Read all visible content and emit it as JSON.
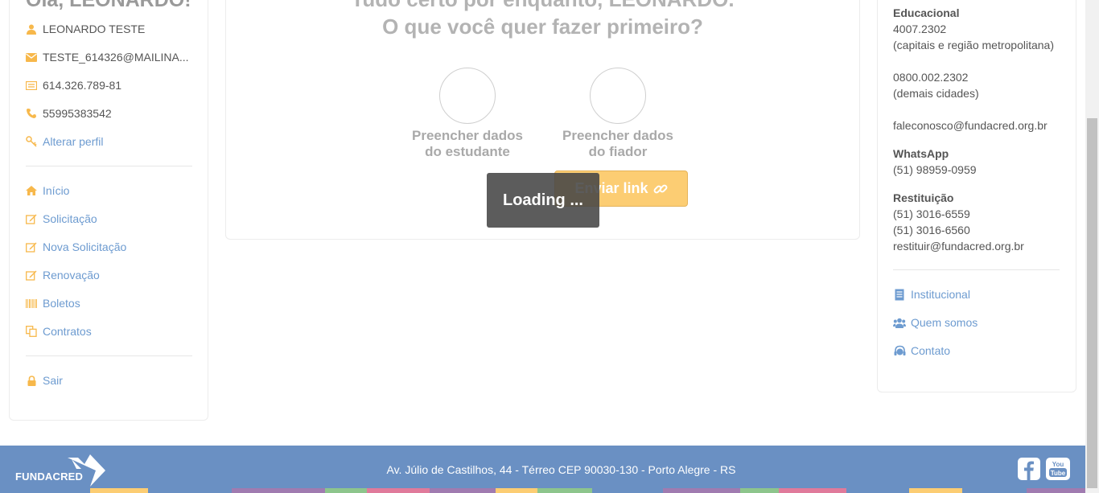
{
  "left": {
    "greeting": "Olá, LEONARDO!",
    "name": "LEONARDO TESTE",
    "email": "TESTE_614326@MAILINA...",
    "cpf": "614.326.789-81",
    "phone": "55995383542",
    "edit_profile": "Alterar perfil",
    "nav": [
      "Início",
      "Solicitação",
      "Nova Solicitação",
      "Renovação",
      "Boletos",
      "Contratos"
    ],
    "logout": "Sair"
  },
  "main": {
    "title_line1": "Tudo certo por enquanto, LEONARDO.",
    "title_line2": "O que você quer fazer primeiro?",
    "option_student_line1": "Preencher dados",
    "option_student_line2": "do estudante",
    "option_guarantor_line1": "Preencher dados",
    "option_guarantor_line2": "do fiador",
    "send_link": "Enviar link",
    "loading": "Loading ..."
  },
  "right": {
    "section_title": "Educacional",
    "phone1": "4007.2302",
    "phone1_note": "(capitais e região metropolitana)",
    "phone2": "0800.002.2302",
    "phone2_note": "(demais cidades)",
    "email": "faleconosco@fundacred.org.br",
    "whatsapp_title": "WhatsApp",
    "whatsapp": "(51) 98959-0959",
    "refund_title": "Restituição",
    "refund_phone1": "(51) 3016-6559",
    "refund_phone2": "(51) 3016-6560",
    "refund_email": "restituir@fundacred.org.br",
    "links": [
      "Institucional",
      "Quem somos",
      "Contato"
    ]
  },
  "footer": {
    "logo": "FUNDACRED",
    "address": "Av. Júlio de Castilhos, 44 - Térreo CEP 90030-130 - Porto Alegre - RS"
  },
  "colors": {
    "accent_orange": "#f7b84b",
    "link_blue": "#6d9bd0",
    "footer_blue": "#6a90c3",
    "button_yellow": "#fccd73"
  }
}
